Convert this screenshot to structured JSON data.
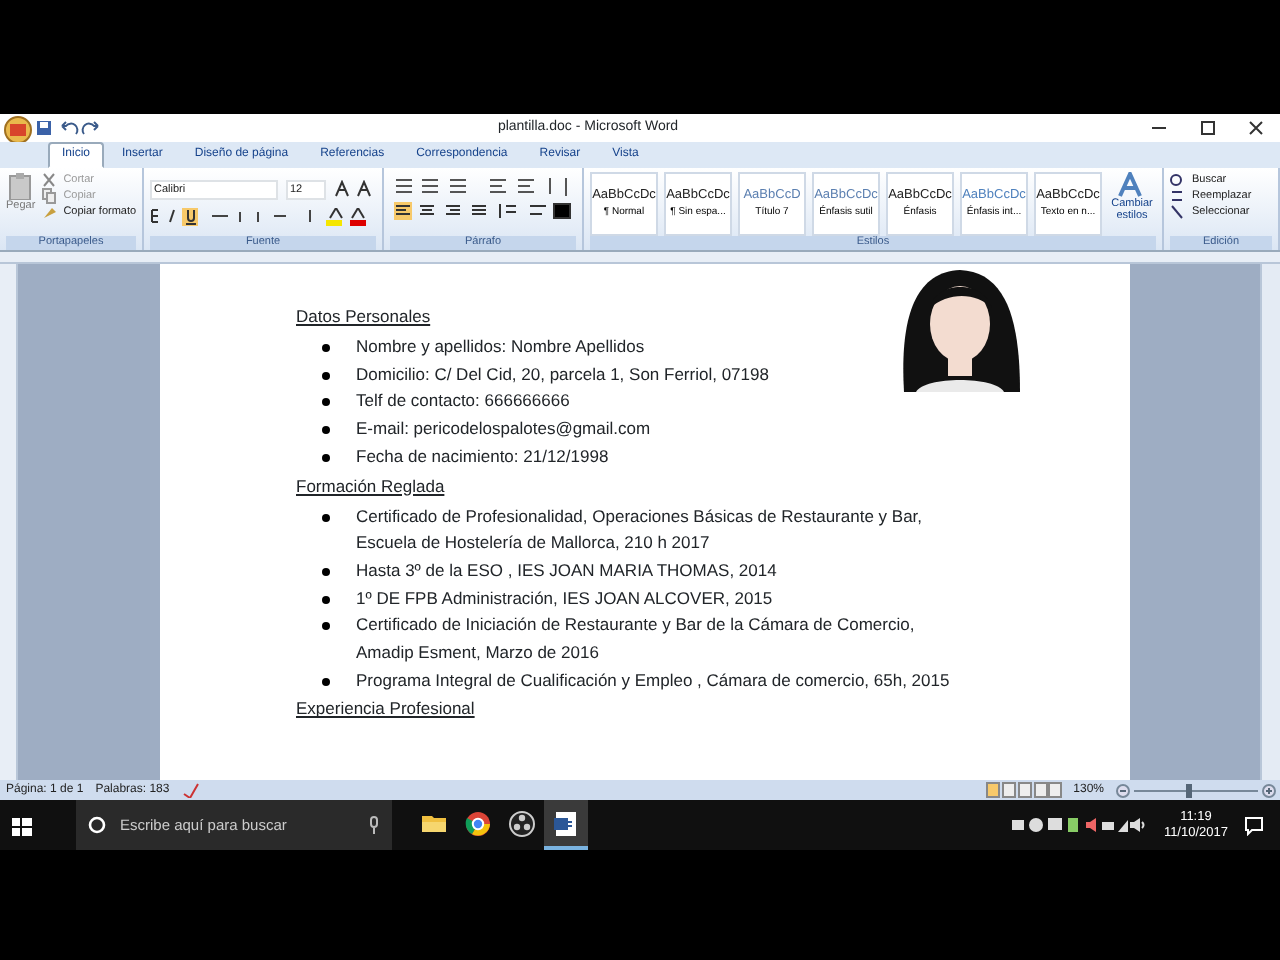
{
  "window": {
    "title": "plantilla.doc - Microsoft Word"
  },
  "tabs": [
    {
      "label": "Inicio",
      "selected": true
    },
    {
      "label": "Insertar",
      "selected": false
    },
    {
      "label": "Diseño de página",
      "selected": false
    },
    {
      "label": "Referencias",
      "selected": false
    },
    {
      "label": "Correspondencia",
      "selected": false
    },
    {
      "label": "Revisar",
      "selected": false
    },
    {
      "label": "Vista",
      "selected": false
    }
  ],
  "clipboard": {
    "paste": "Pegar",
    "items": [
      "Cortar",
      "Copiar",
      "Copiar formato"
    ],
    "label": "Portapapeles"
  },
  "font": {
    "name": "Calibri",
    "size": "12",
    "label": "Fuente"
  },
  "paragraph": {
    "label": "Párrafo"
  },
  "styles": {
    "items": [
      {
        "sample": "AaBbCcDc",
        "name": "¶ Normal"
      },
      {
        "sample": "AaBbCcDc",
        "name": "¶ Sin espa..."
      },
      {
        "sample": "AaBbCcD",
        "name": "Título 7"
      },
      {
        "sample": "AaBbCcDc",
        "name": "Énfasis sutil"
      },
      {
        "sample": "AaBbCcDc",
        "name": "Énfasis"
      },
      {
        "sample": "AaBbCcDc",
        "name": "Énfasis int..."
      },
      {
        "sample": "AaBbCcDc",
        "name": "Texto en n..."
      }
    ],
    "change": "Cambiar estilos",
    "label": "Estilos"
  },
  "editing": {
    "items": [
      "Buscar",
      "Reemplazar",
      "Seleccionar"
    ],
    "label": "Edición"
  },
  "document": {
    "sections": [
      {
        "heading": "Datos Personales",
        "items": [
          {
            "lines": [
              "Nombre y apellidos: Nombre Apellidos"
            ]
          },
          {
            "lines": [
              "Domicilio:  C/  Del Cid, 20, parcela 1, Son Ferriol, 07198"
            ]
          },
          {
            "lines": [
              "Telf de contacto: 666666666"
            ]
          },
          {
            "lines": [
              "E-mail: pericodelospalotes@gmail.com"
            ]
          },
          {
            "lines": [
              "Fecha de nacimiento: 21/12/1998"
            ]
          }
        ]
      },
      {
        "heading": "Formación Reglada",
        "items": [
          {
            "lines": [
              "Certificado de Profesionalidad, Operaciones Básicas de Restaurante y Bar,",
              "Escuela de Hostelería de Mallorca,  210 h 2017"
            ]
          },
          {
            "lines": [
              "Hasta 3º de la ESO , IES JOAN MARIA THOMAS, 2014"
            ]
          },
          {
            "lines": [
              "1º  DE FPB Administración, IES JOAN ALCOVER, 2015"
            ]
          },
          {
            "lines": [
              "Certificado de Iniciación de Restaurante y Bar de la Cámara de Comercio,",
              "Amadip Esment, Marzo de 2016"
            ]
          },
          {
            "lines": [
              "Programa Integral de Cualificación y Empleo , Cámara de comercio, 65h, 2015"
            ]
          }
        ]
      },
      {
        "heading": "Experiencia Profesional"
      }
    ]
  },
  "status_bar": {
    "page": "Página: 1 de 1",
    "words": "Palabras: 183",
    "zoom": "130%",
    "zoom_slider": {
      "level": 0.45
    }
  },
  "taskbar": {
    "search": {
      "placeholder": "Escribe aquí para buscar"
    },
    "apps": [
      {
        "kind": "folder",
        "selected": false
      },
      {
        "kind": "browser",
        "selected": false
      },
      {
        "kind": "recorder",
        "selected": false
      },
      {
        "kind": "word",
        "selected": true
      }
    ],
    "time": "11:19",
    "date": "11/10/2017"
  }
}
